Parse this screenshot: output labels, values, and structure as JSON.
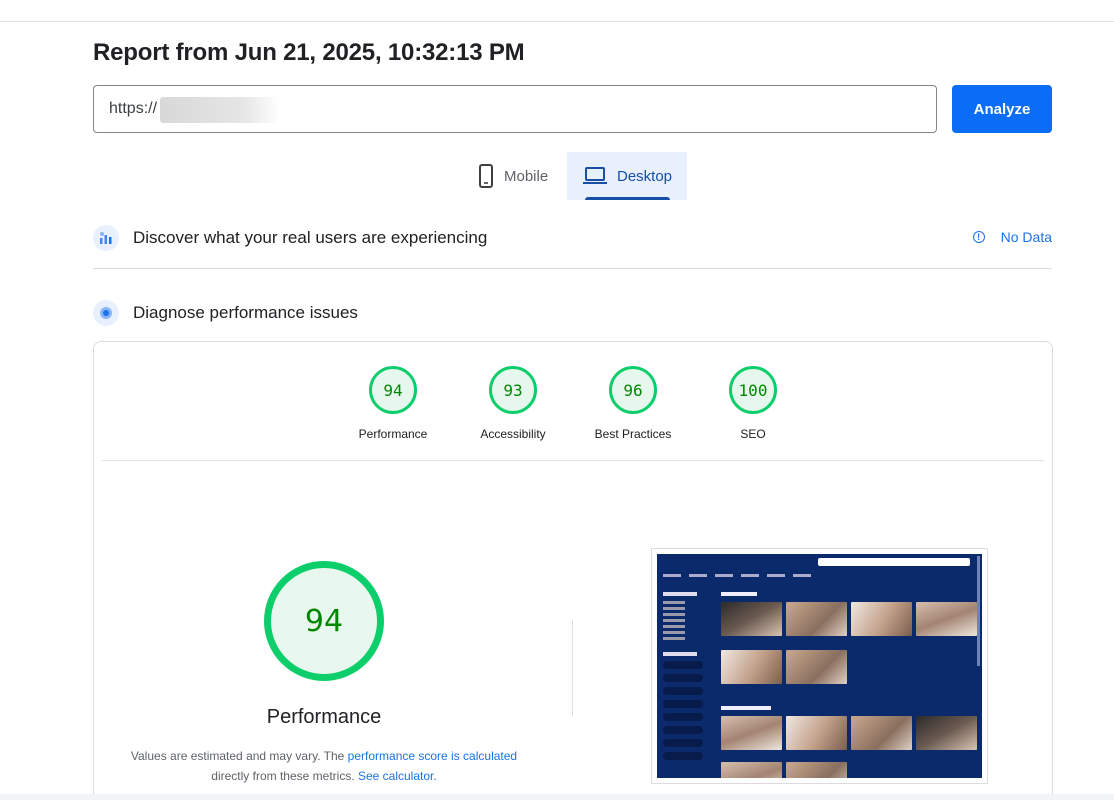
{
  "report": {
    "title": "Report from Jun 21, 2025, 10:32:13 PM"
  },
  "url_input": {
    "value": "https://",
    "redacted": true
  },
  "analyze_button": {
    "label": "Analyze"
  },
  "tabs": [
    {
      "label": "Mobile",
      "icon": "phone-icon",
      "selected": false
    },
    {
      "label": "Desktop",
      "icon": "laptop-icon",
      "selected": true
    }
  ],
  "field_data": {
    "title": "Discover what your real users are experiencing",
    "status": "No Data",
    "icon": "people-chart-icon"
  },
  "lab_data": {
    "title": "Diagnose performance issues",
    "icon": "gauge-icon"
  },
  "scores": [
    {
      "label": "Performance",
      "value": "94"
    },
    {
      "label": "Accessibility",
      "value": "93"
    },
    {
      "label": "Best Practices",
      "value": "96"
    },
    {
      "label": "SEO",
      "value": "100"
    }
  ],
  "performance": {
    "score": "94",
    "label": "Performance",
    "note_prefix": "Values are estimated and may vary. The ",
    "note_link1": "performance score is calculated",
    "note_middle": " directly from these metrics. ",
    "note_link2": "See calculator.",
    "note_suffix": ""
  },
  "colors": {
    "accent": "#1a73e8",
    "button": "#0b6cf6",
    "pass": "#0cce6b",
    "pass_text": "#008800",
    "tab_bg": "#e8f0fe"
  }
}
